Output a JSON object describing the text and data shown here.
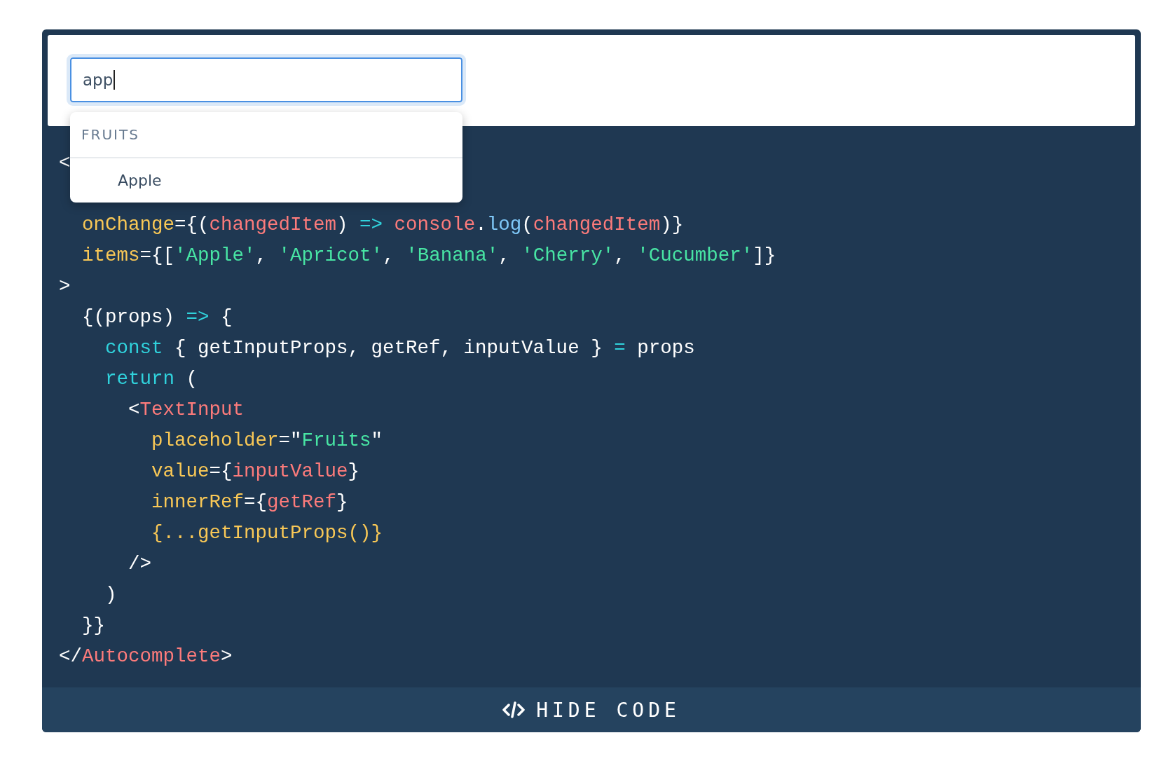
{
  "search": {
    "value": "app"
  },
  "dropdown": {
    "group": "FRUITS",
    "items": [
      {
        "label": "Apple"
      }
    ]
  },
  "code": [
    [
      {
        "kind": "plain",
        "text": "<"
      }
    ],
    [
      {
        "kind": "attr",
        "text": "  onChange"
      },
      {
        "kind": "plain",
        "text": "={("
      },
      {
        "kind": "var",
        "text": "changedItem"
      },
      {
        "kind": "plain",
        "text": ") "
      },
      {
        "kind": "keyword",
        "text": "=>"
      },
      {
        "kind": "var",
        "text": " console"
      },
      {
        "kind": "plain",
        "text": "."
      },
      {
        "kind": "func",
        "text": "log"
      },
      {
        "kind": "plain",
        "text": "("
      },
      {
        "kind": "var",
        "text": "changedItem"
      },
      {
        "kind": "plain",
        "text": ")}"
      }
    ],
    [
      {
        "kind": "attr",
        "text": "  items"
      },
      {
        "kind": "plain",
        "text": "={["
      },
      {
        "kind": "string",
        "text": "'Apple'"
      },
      {
        "kind": "plain",
        "text": ", "
      },
      {
        "kind": "string",
        "text": "'Apricot'"
      },
      {
        "kind": "plain",
        "text": ", "
      },
      {
        "kind": "string",
        "text": "'Banana'"
      },
      {
        "kind": "plain",
        "text": ", "
      },
      {
        "kind": "string",
        "text": "'Cherry'"
      },
      {
        "kind": "plain",
        "text": ", "
      },
      {
        "kind": "string",
        "text": "'Cucumber'"
      },
      {
        "kind": "plain",
        "text": "]}"
      }
    ],
    [
      {
        "kind": "plain",
        "text": ">"
      }
    ],
    [
      {
        "kind": "plain",
        "text": "  {(props) "
      },
      {
        "kind": "keyword",
        "text": "=>"
      },
      {
        "kind": "plain",
        "text": " {"
      }
    ],
    [
      {
        "kind": "keyword",
        "text": "    const"
      },
      {
        "kind": "plain",
        "text": " { getInputProps, getRef, inputValue } "
      },
      {
        "kind": "keyword",
        "text": "="
      },
      {
        "kind": "plain",
        "text": " props"
      }
    ],
    [
      {
        "kind": "keyword",
        "text": "    return"
      },
      {
        "kind": "plain",
        "text": " ("
      }
    ],
    [
      {
        "kind": "plain",
        "text": "      <"
      },
      {
        "kind": "var",
        "text": "TextInput"
      }
    ],
    [
      {
        "kind": "attr",
        "text": "        placeholder"
      },
      {
        "kind": "plain",
        "text": "=\""
      },
      {
        "kind": "string",
        "text": "Fruits"
      },
      {
        "kind": "plain",
        "text": "\""
      }
    ],
    [
      {
        "kind": "attr",
        "text": "        value"
      },
      {
        "kind": "plain",
        "text": "={"
      },
      {
        "kind": "var",
        "text": "inputValue"
      },
      {
        "kind": "plain",
        "text": "}"
      }
    ],
    [
      {
        "kind": "attr",
        "text": "        innerRef"
      },
      {
        "kind": "plain",
        "text": "={"
      },
      {
        "kind": "var",
        "text": "getRef"
      },
      {
        "kind": "plain",
        "text": "}"
      }
    ],
    [
      {
        "kind": "attr",
        "text": "        {...getInputProps()}"
      }
    ],
    [
      {
        "kind": "plain",
        "text": "      />"
      }
    ],
    [
      {
        "kind": "plain",
        "text": "    )"
      }
    ],
    [
      {
        "kind": "plain",
        "text": "  }}"
      }
    ],
    [
      {
        "kind": "plain",
        "text": "</"
      },
      {
        "kind": "var",
        "text": "Autocomplete"
      },
      {
        "kind": "plain",
        "text": ">"
      }
    ]
  ],
  "toggle_button": {
    "label": "HIDE CODE"
  }
}
